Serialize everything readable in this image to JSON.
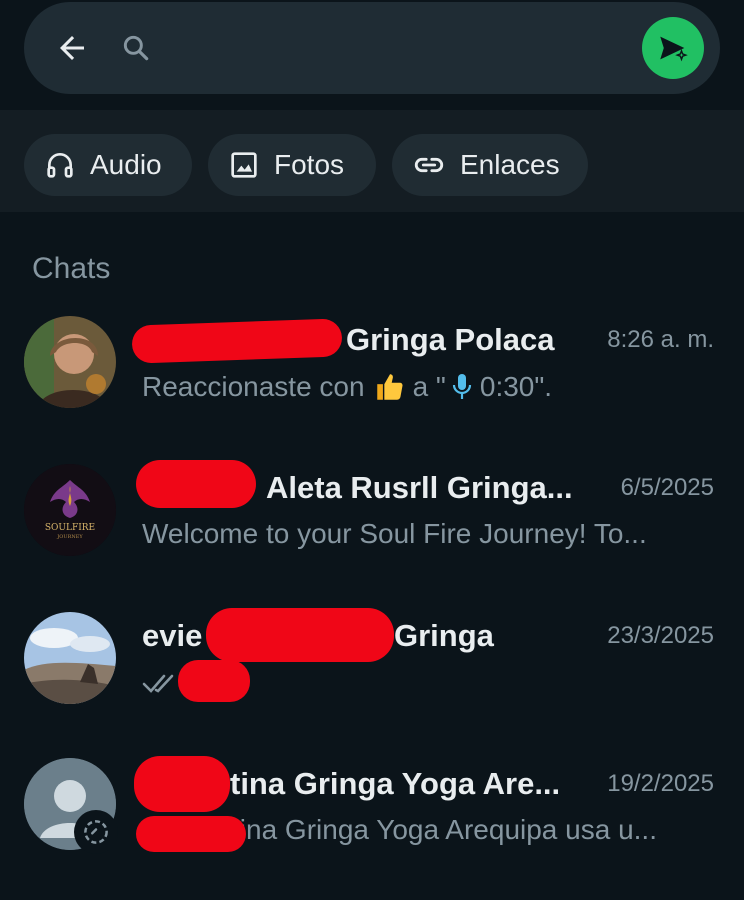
{
  "search": {
    "placeholder": "",
    "value": ""
  },
  "filters": [
    {
      "label": "Audio",
      "icon": "headphones-icon"
    },
    {
      "label": "Fotos",
      "icon": "image-icon"
    },
    {
      "label": "Enlaces",
      "icon": "link-icon"
    }
  ],
  "section_title": "Chats",
  "chats": [
    {
      "name": "Gringa Polaca",
      "time": "8:26 a. m.",
      "preview_prefix": "Reaccionaste con",
      "preview_mid": "a \"",
      "preview_suffix": "0:30\"."
    },
    {
      "name": "Aleta Rusrll Gringa...",
      "time": "6/5/2025",
      "preview": "Welcome to your Soul Fire Journey! To...",
      "avatar_text": "SOULFIRE",
      "avatar_subtext": "JOURNEY"
    },
    {
      "name_prefix": "evie",
      "name_suffix": "Gringa",
      "time": "23/3/2025"
    },
    {
      "name": "tina Gringa Yoga Are...",
      "time": "19/2/2025",
      "preview": "tina Gringa Yoga Arequipa usa u..."
    }
  ],
  "colors": {
    "background": "#0b141a",
    "accent": "#21c063",
    "mic": "#53bdeb",
    "redaction": "#f00617"
  }
}
